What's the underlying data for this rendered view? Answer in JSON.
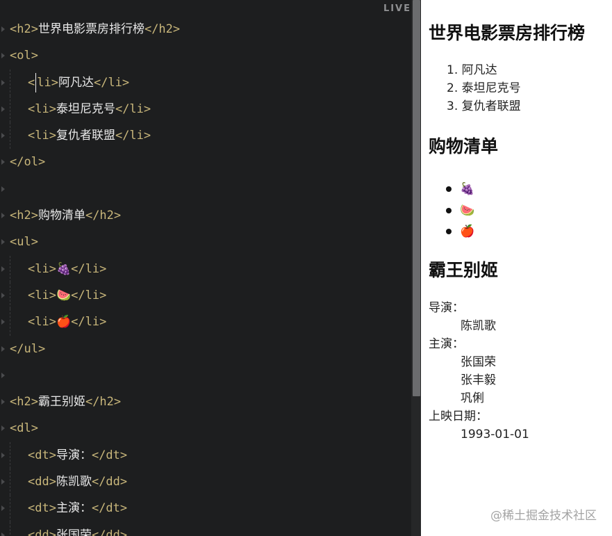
{
  "editor": {
    "live_label": "LIVE",
    "lines": [
      {
        "indent": 0,
        "tokens": [
          {
            "t": "tag",
            "v": "<h2>"
          },
          {
            "t": "text",
            "v": "世界电影票房排行榜"
          },
          {
            "t": "tag",
            "v": "</h2>"
          }
        ]
      },
      {
        "indent": 0,
        "tokens": [
          {
            "t": "tag",
            "v": "<ol>"
          }
        ]
      },
      {
        "indent": 1,
        "tokens": [
          {
            "t": "tag",
            "v": "<"
          },
          {
            "t": "caret",
            "v": ""
          },
          {
            "t": "tag",
            "v": "li>"
          },
          {
            "t": "text",
            "v": "阿凡达"
          },
          {
            "t": "tag",
            "v": "</li>"
          }
        ]
      },
      {
        "indent": 1,
        "tokens": [
          {
            "t": "tag",
            "v": "<li>"
          },
          {
            "t": "text",
            "v": "泰坦尼克号"
          },
          {
            "t": "tag",
            "v": "</li>"
          }
        ]
      },
      {
        "indent": 1,
        "tokens": [
          {
            "t": "tag",
            "v": "<li>"
          },
          {
            "t": "text",
            "v": "复仇者联盟"
          },
          {
            "t": "tag",
            "v": "</li>"
          }
        ]
      },
      {
        "indent": 0,
        "tokens": [
          {
            "t": "tag",
            "v": "</ol>"
          }
        ]
      },
      {
        "indent": 0,
        "tokens": []
      },
      {
        "indent": 0,
        "tokens": [
          {
            "t": "tag",
            "v": "<h2>"
          },
          {
            "t": "text",
            "v": "购物清单"
          },
          {
            "t": "tag",
            "v": "</h2>"
          }
        ]
      },
      {
        "indent": 0,
        "tokens": [
          {
            "t": "tag",
            "v": "<ul>"
          }
        ]
      },
      {
        "indent": 1,
        "tokens": [
          {
            "t": "tag",
            "v": "<li>"
          },
          {
            "t": "text",
            "v": "🍇"
          },
          {
            "t": "tag",
            "v": "</li>"
          }
        ]
      },
      {
        "indent": 1,
        "tokens": [
          {
            "t": "tag",
            "v": "<li>"
          },
          {
            "t": "text",
            "v": "🍉"
          },
          {
            "t": "tag",
            "v": "</li>"
          }
        ]
      },
      {
        "indent": 1,
        "tokens": [
          {
            "t": "tag",
            "v": "<li>"
          },
          {
            "t": "text",
            "v": "🍎"
          },
          {
            "t": "tag",
            "v": "</li>"
          }
        ]
      },
      {
        "indent": 0,
        "tokens": [
          {
            "t": "tag",
            "v": "</ul>"
          }
        ]
      },
      {
        "indent": 0,
        "tokens": []
      },
      {
        "indent": 0,
        "tokens": [
          {
            "t": "tag",
            "v": "<h2>"
          },
          {
            "t": "text",
            "v": "霸王别姬"
          },
          {
            "t": "tag",
            "v": "</h2>"
          }
        ]
      },
      {
        "indent": 0,
        "tokens": [
          {
            "t": "tag",
            "v": "<dl>"
          }
        ]
      },
      {
        "indent": 1,
        "tokens": [
          {
            "t": "tag",
            "v": "<dt>"
          },
          {
            "t": "text",
            "v": "导演："
          },
          {
            "t": "tag",
            "v": "</dt>"
          }
        ]
      },
      {
        "indent": 1,
        "tokens": [
          {
            "t": "tag",
            "v": "<dd>"
          },
          {
            "t": "text",
            "v": "陈凯歌"
          },
          {
            "t": "tag",
            "v": "</dd>"
          }
        ]
      },
      {
        "indent": 1,
        "tokens": [
          {
            "t": "tag",
            "v": "<dt>"
          },
          {
            "t": "text",
            "v": "主演："
          },
          {
            "t": "tag",
            "v": "</dt>"
          }
        ]
      },
      {
        "indent": 1,
        "tokens": [
          {
            "t": "tag",
            "v": "<dd>"
          },
          {
            "t": "text",
            "v": "张国荣"
          },
          {
            "t": "tag",
            "v": "</dd>"
          }
        ]
      }
    ]
  },
  "preview": {
    "title1": "世界电影票房排行榜",
    "ranking": [
      "阿凡达",
      "泰坦尼克号",
      "复仇者联盟"
    ],
    "title2": "购物清单",
    "shopping": [
      "🍇",
      "🍉",
      "🍎"
    ],
    "title3": "霸王别姬",
    "details": [
      {
        "type": "dt",
        "text": "导演："
      },
      {
        "type": "dd",
        "text": "陈凯歌"
      },
      {
        "type": "dt",
        "text": "主演："
      },
      {
        "type": "dd",
        "text": "张国荣"
      },
      {
        "type": "dd",
        "text": "张丰毅"
      },
      {
        "type": "dd",
        "text": "巩俐"
      },
      {
        "type": "dt",
        "text": "上映日期："
      },
      {
        "type": "dd",
        "text": "1993-01-01"
      }
    ]
  },
  "watermark": "@稀土掘金技术社区",
  "colors": {
    "editor_bg": "#1d1e1f",
    "tag": "#c9b77b",
    "text": "#e9e9e9",
    "preview_bg": "#ffffff"
  }
}
